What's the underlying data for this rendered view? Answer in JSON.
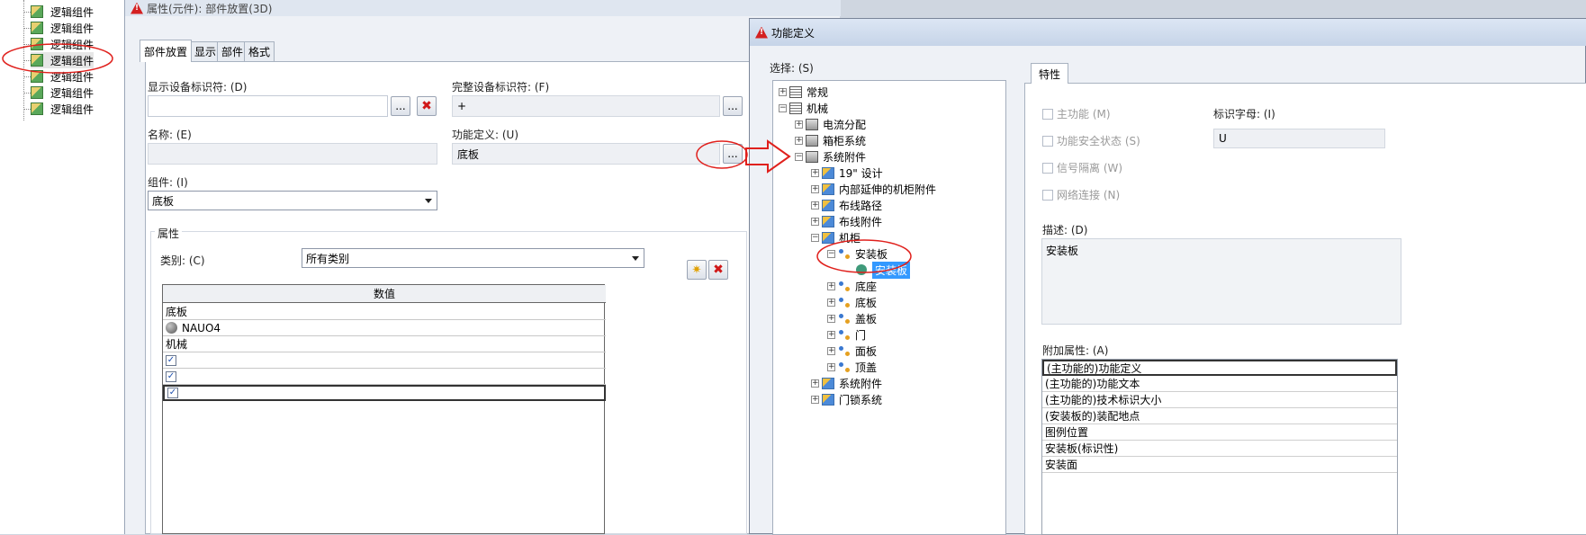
{
  "left_tree": {
    "items": [
      "逻辑组件",
      "逻辑组件",
      "逻辑组件",
      "逻辑组件",
      "逻辑组件",
      "逻辑组件",
      "逻辑组件"
    ]
  },
  "prop_window": {
    "title": "属性(元件): 部件放置(3D)",
    "tabs": [
      "部件放置",
      "显示",
      "部件",
      "格式"
    ],
    "display_id_label": "显示设备标识符: (D)",
    "display_id_value": "",
    "full_id_label": "完整设备标识符: (F)",
    "full_id_value": "+",
    "name_label": "名称: (E)",
    "name_value": "",
    "func_def_label": "功能定义: (U)",
    "func_def_value": "底板",
    "component_label": "组件: (I)",
    "component_value": "底板",
    "browse_label": "...",
    "attr_group_label": "属性",
    "category_label": "类别: (C)",
    "category_value": "所有类别",
    "grid_header": "数值",
    "grid_rows": [
      {
        "type": "text",
        "text": "底板"
      },
      {
        "type": "globe",
        "text": "NAUO4"
      },
      {
        "type": "text",
        "text": "机械"
      },
      {
        "type": "check",
        "checked": true
      },
      {
        "type": "check",
        "checked": true
      },
      {
        "type": "check",
        "checked": true
      }
    ]
  },
  "func_dialog": {
    "title": "功能定义",
    "select_label": "选择: (S)",
    "tab_label": "特性",
    "tree": [
      {
        "label": "常规",
        "level": 0,
        "icon": "folder",
        "exp": "+"
      },
      {
        "label": "机械",
        "level": 0,
        "icon": "folder",
        "exp": "−"
      },
      {
        "label": "电流分配",
        "level": 1,
        "icon": "cab",
        "exp": "+"
      },
      {
        "label": "箱柜系统",
        "level": 1,
        "icon": "cab",
        "exp": "+"
      },
      {
        "label": "系统附件",
        "level": 1,
        "icon": "cab",
        "exp": "−"
      },
      {
        "label": "19\" 设计",
        "level": 2,
        "icon": "blue",
        "exp": "+"
      },
      {
        "label": "内部延伸的机柜附件",
        "level": 2,
        "icon": "blue",
        "exp": "+"
      },
      {
        "label": "布线路径",
        "level": 2,
        "icon": "blue",
        "exp": "+"
      },
      {
        "label": "布线附件",
        "level": 2,
        "icon": "blue",
        "exp": "+"
      },
      {
        "label": "机柜",
        "level": 2,
        "icon": "blue",
        "exp": "−"
      },
      {
        "label": "安装板",
        "level": 3,
        "icon": "dots",
        "exp": "−"
      },
      {
        "label": "安装板",
        "level": 4,
        "icon": "circle",
        "exp": "",
        "selected": true
      },
      {
        "label": "底座",
        "level": 3,
        "icon": "dots",
        "exp": "+"
      },
      {
        "label": "底板",
        "level": 3,
        "icon": "dots",
        "exp": "+"
      },
      {
        "label": "盖板",
        "level": 3,
        "icon": "dots",
        "exp": "+"
      },
      {
        "label": "门",
        "level": 3,
        "icon": "dots",
        "exp": "+"
      },
      {
        "label": "面板",
        "level": 3,
        "icon": "dots",
        "exp": "+"
      },
      {
        "label": "顶盖",
        "level": 3,
        "icon": "dots",
        "exp": "+"
      },
      {
        "label": "系统附件",
        "level": 2,
        "icon": "blue",
        "exp": "+"
      },
      {
        "label": "门锁系统",
        "level": 2,
        "icon": "blue",
        "exp": "+"
      }
    ],
    "checkboxes": [
      "主功能 (M)",
      "功能安全状态 (S)",
      "信号隔离 (W)",
      "网络连接 (N)"
    ],
    "id_letter_label": "标识字母: (I)",
    "id_letter_value": "U",
    "desc_label": "描述: (D)",
    "desc_value": "安装板",
    "extra_label": "附加属性: (A)",
    "extra_rows": [
      "(主功能的)功能定义",
      "(主功能的)功能文本",
      "(主功能的)技术标识大小",
      "(安装板的)装配地点",
      "图例位置",
      "安装板(标识性)",
      "安装面"
    ]
  },
  "colors": {
    "selection": "#3399ff",
    "annotation_red": "#e0201c"
  }
}
